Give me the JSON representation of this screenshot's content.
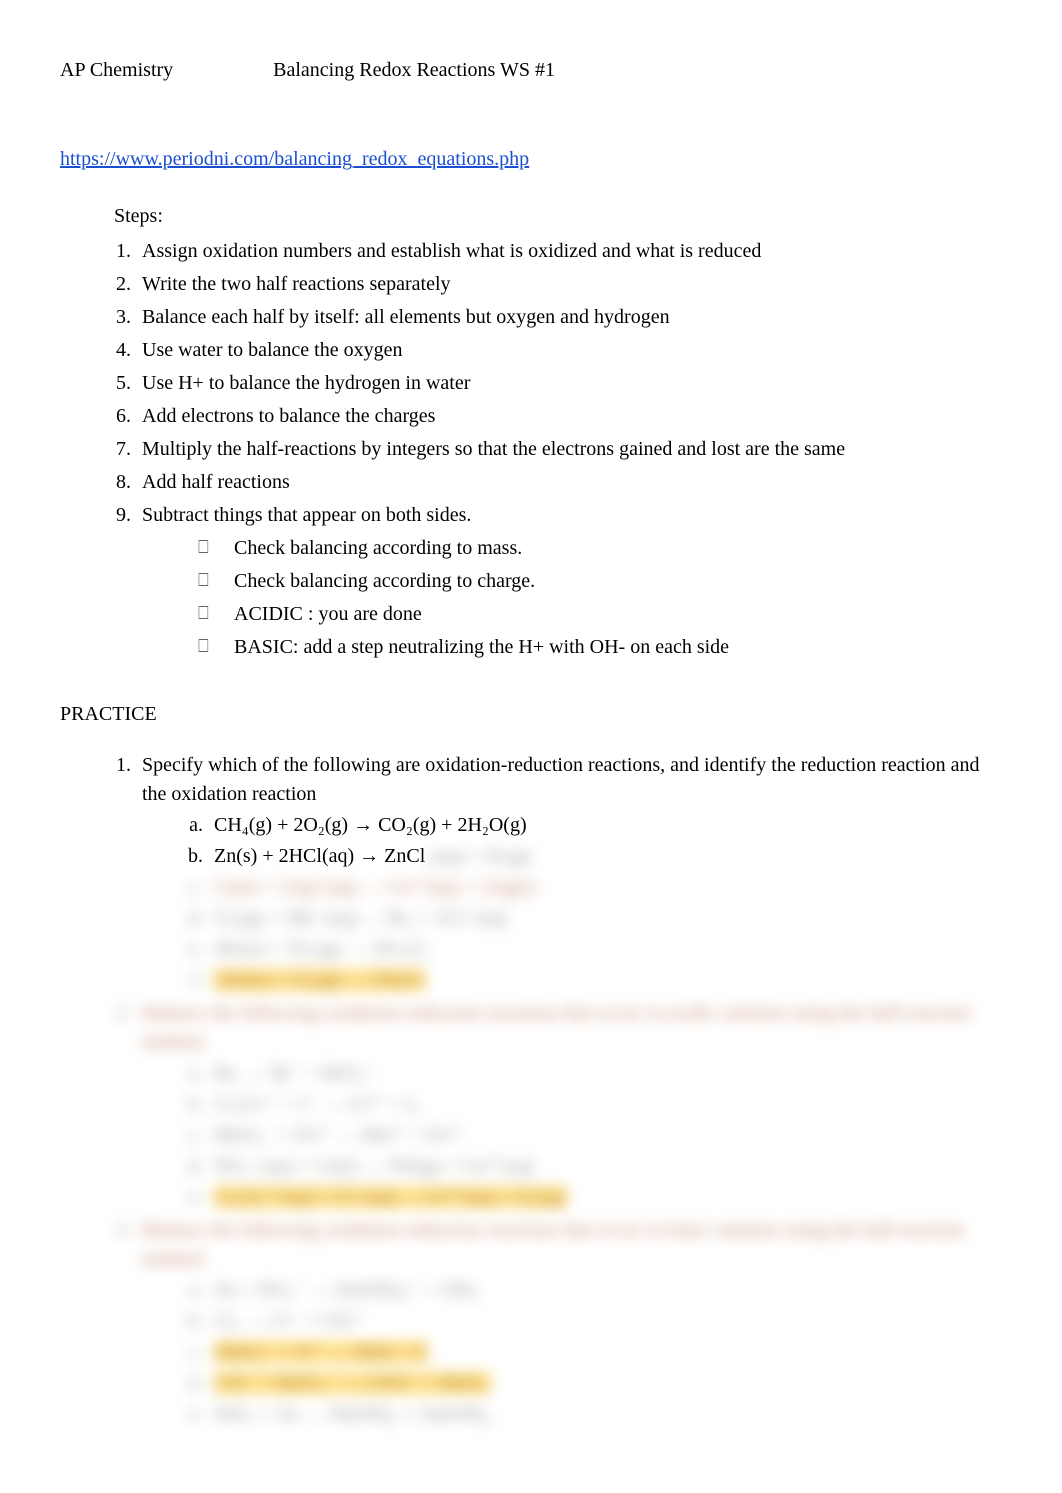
{
  "header": {
    "course": "AP Chemistry",
    "title": "Balancing Redox Reactions WS #1"
  },
  "link_text": "https://www.periodni.com/balancing_redox_equations.php",
  "steps_label": "Steps:",
  "steps": [
    "Assign oxidation numbers and establish what is oxidized and what is reduced",
    "Write the two half reactions separately",
    "Balance each half by itself: all elements but oxygen and hydrogen",
    "Use water to balance the oxygen",
    "Use H+ to balance the hydrogen in water",
    "Add electrons to balance the charges",
    "Multiply the half-reactions by integers so that the electrons gained and lost are the same",
    "Add half reactions",
    "Subtract things that appear on both sides."
  ],
  "checks": [
    "Check balancing according to mass.",
    "Check balancing according to charge.",
    "ACIDIC : you are done",
    "BASIC: add a step neutralizing the H+ with OH- on each side"
  ],
  "practice_heading": "PRACTICE",
  "practice_q1": "Specify which of the following are oxidation-reduction reactions, and identify the reduction reaction and the oxidation reaction",
  "q1a": "CH₄(g) + 2O₂(g) → CO₂(g) + 2H₂O(g)",
  "q1b": "Zn(s) + 2HCl(aq) → ZnCl",
  "blur": {
    "q1b_tail": "₂(aq) + H₂(g)",
    "q1c": "Cu(s) + 2Ag⁺(aq) → Cu²⁺(aq) + 2Ag(s)",
    "q1d": "Cl₂(g) + 2Br⁻(aq) → Br₂ + 2Cl⁻(aq)",
    "q1e": "4Fe(s) + 3O₂(g) → 2Fe₂O₃",
    "q1f": "2Na(s) + Cl₂(g) → 2NaCl",
    "q2": "Balance the following oxidation-reduction reactions that occur in acidic solution using the half-reaction method.",
    "q2a": "Br₂ → Br⁻ + BrO₃⁻",
    "q2b": "Cr₂O₇²⁻ + I⁻ → Cr³⁺ + I₂",
    "q2c": "MnO₄⁻ + Fe²⁺ → Mn²⁺ + Fe³⁺",
    "q2d": "NO₃⁻(aq) + Cu(s) → NO(g) + Cu²⁺(aq)",
    "q2e": "Cr₂O₇²⁻(aq) + Cl⁻(aq) → Cr³⁺(aq) + Cl₂(g)",
    "q3": "Balance the following oxidation-reduction reactions that occur in basic solution using the half-reaction method.",
    "q3a": "Zn + NO₃⁻ → Zn(OH)₄²⁻ + NH₃",
    "q3b": "Cl₂ → Cl⁻ + ClO⁻",
    "q3c": "MnO₄⁻ + S²⁻ → MnS + S",
    "q3d": "CN⁻ + MnO₄⁻ → CNO⁻ + MnO₂",
    "q3e": "NiO₂ + Zn → Ni(OH)₂ + Zn(OH)₂"
  }
}
